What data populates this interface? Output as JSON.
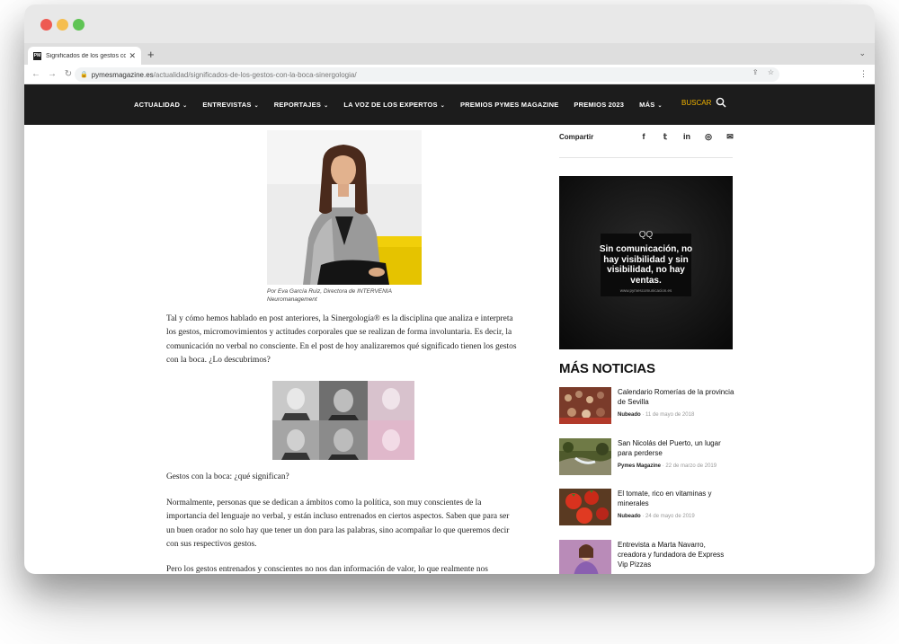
{
  "browser": {
    "tab_title": "Significados de los gestos co",
    "favicon_text": "PM",
    "url_domain": "pymesmagazine.es",
    "url_path": "/actualidad/significados-de-los-gestos-con-la-boca-sinergologia/"
  },
  "nav": {
    "items": [
      {
        "label": "ACTUALIDAD",
        "dropdown": true
      },
      {
        "label": "ENTREVISTAS",
        "dropdown": true
      },
      {
        "label": "REPORTAJES",
        "dropdown": true
      },
      {
        "label": "LA VOZ DE LOS EXPERTOS",
        "dropdown": true
      },
      {
        "label": "PREMIOS PYMES MAGAZINE",
        "dropdown": false
      },
      {
        "label": "PREMIOS 2023",
        "dropdown": false
      },
      {
        "label": "MÁS",
        "dropdown": true
      }
    ],
    "search_label": "BUSCAR",
    "accent_color": "#f2b400"
  },
  "article": {
    "caption": "Por Eva García Ruiz, Directora de INTERVENIA Neuromanagement",
    "p1": "Tal y cómo hemos hablado en post anteriores, la Sinergología® es la disciplina que analiza e interpreta los gestos, micromovimientos y actitudes corporales que se realizan de forma involuntaria. Es decir, la comunicación no verbal no consciente. En el post de hoy analizaremos qué significado tienen los gestos con la boca. ¿Lo descubrimos?",
    "subheading": "Gestos con la boca: ¿qué significan?",
    "p2": "Normalmente, personas que se dedican a ámbitos como la política, son muy conscientes de la importancia del lenguaje no verbal, y están incluso entrenados en ciertos aspectos. Saben que para ser un buen orador no solo hay que tener un don para las palabras, sino acompañar lo que queremos decir con sus respectivos gestos.",
    "p3": "Pero los gestos entrenados y conscientes no nos dan información de valor, lo que realmente nos"
  },
  "sidebar": {
    "share_label": "Compartir",
    "share_icons": [
      "facebook-icon",
      "twitter-icon",
      "linkedin-icon",
      "reddit-icon",
      "email-icon"
    ],
    "ad": {
      "quote": "QQ",
      "text": "Sin comunicación, no hay visibilidad y sin visibilidad, no hay ventas.",
      "url": "www.pymescomunicacion.es"
    },
    "more_title": "MÁS NOTICIAS",
    "news": [
      {
        "title": "Calendario Romerías de la provincia de Sevilla",
        "author": "Nubeado",
        "date": "11 de mayo de 2018"
      },
      {
        "title": "San Nicolás del Puerto, un lugar para perderse",
        "author": "Pymes Magazine",
        "date": "22 de marzo de 2019"
      },
      {
        "title": "El tomate, rico en vitaminas y minerales",
        "author": "Nubeado",
        "date": "24 de mayo de 2019"
      },
      {
        "title": "Entrevista a Marta Navarro, creadora y fundadora de Express Vip Pizzas",
        "author": "",
        "date": ""
      }
    ]
  }
}
